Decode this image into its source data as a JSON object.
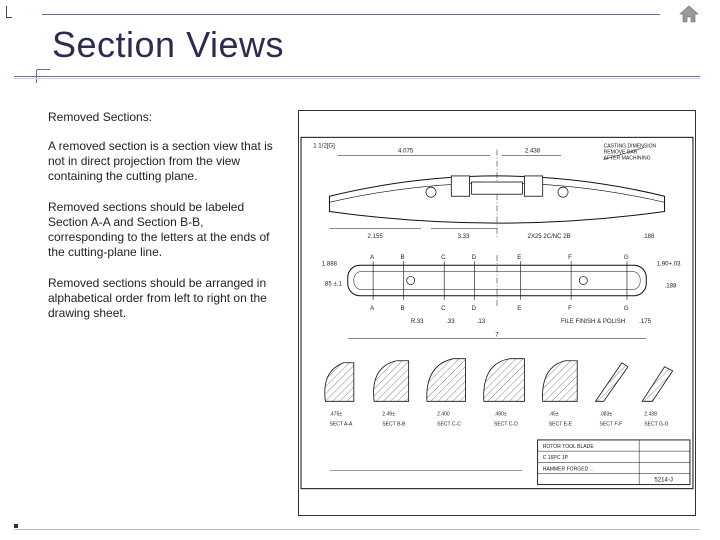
{
  "nav": {
    "home_icon_name": "home-icon"
  },
  "title": "Section Views",
  "text": {
    "subhead": "Removed Sections:",
    "p1": "A removed section is a section view that is not in direct projection from the view containing the cutting plane.",
    "p2": "Removed sections should be labeled Section A-A  and Section B-B, corresponding to the letters at the ends of the cutting-plane line.",
    "p3": "Removed sections should be arranged in alphabetical order from left to right on the drawing sheet."
  },
  "figure": {
    "caption_top_left": "1 1/2[G]",
    "dim_top": "4.075",
    "dim_remove": "2.438",
    "note_right_top": "CASTING DIMENSION\nREMOVE BAR\nAFTER MACHINING",
    "dim_lower_left": "2.155",
    "dim_lower_mid": "3.33",
    "dim_lower_right": "7",
    "hole_note": "2X25  2C/NC  2B",
    "dim_188": ".188",
    "profile": {
      "letters": [
        "A",
        "B",
        "C",
        "D",
        "E",
        "F",
        "G"
      ],
      "arrow_dim_left": "1.888",
      "arrow_dim_right": "1.90+.03",
      "dim_85": ".85 ±.1",
      "dim_188_2": ".188",
      "dim_175": ".175",
      "note_file": "FILE FINISH & POLISH",
      "dim_R33": "R.33",
      "dim_33": ".33",
      "dim_13": ".13"
    },
    "sections": [
      {
        "label": "SECT A-A",
        "d1": ".475±"
      },
      {
        "label": "SECT B-B",
        "d1": "2.49±"
      },
      {
        "label": "SECT C-C",
        "d1": "2.400"
      },
      {
        "label": "SECT C-D",
        "d1": ".490±"
      },
      {
        "label": "SECT E-E",
        "d1": ".45±"
      },
      {
        "label": "SECT F-F",
        "d1": ".083±"
      },
      {
        "label": "SECT G-G",
        "d1": "2.438"
      }
    ],
    "titleblock": {
      "part": "ROTOR  TOOL  BLADE",
      "mat": "C  16PC 1P",
      "proc": "HAMMER FORGED ...",
      "sheet": "5214-J"
    }
  }
}
